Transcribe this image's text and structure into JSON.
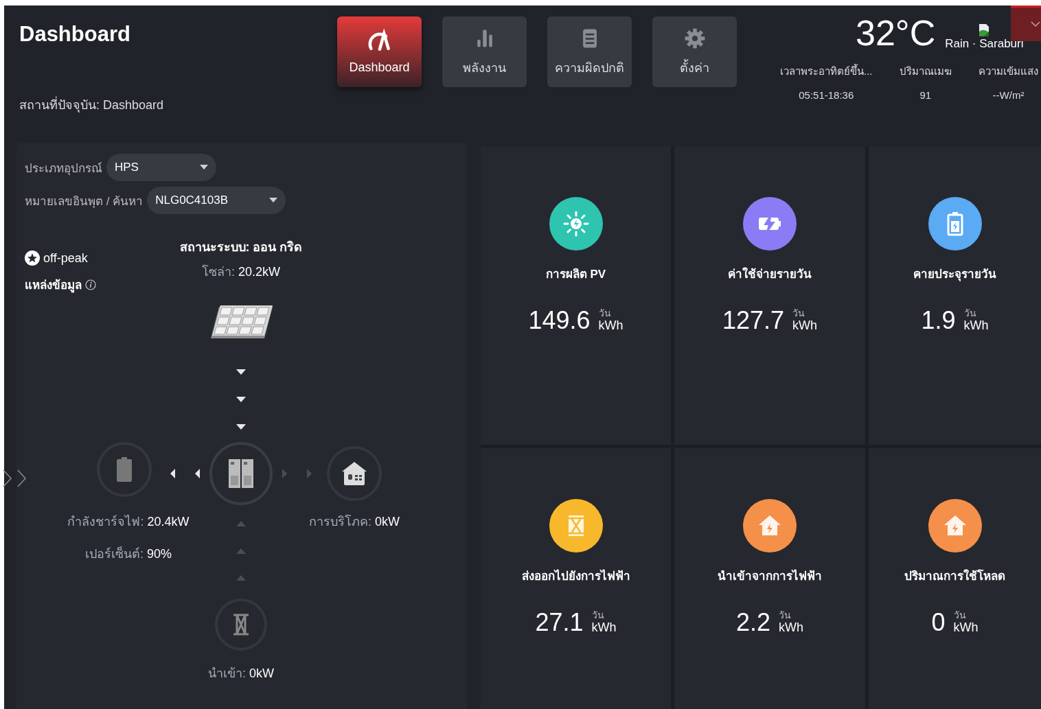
{
  "header": {
    "title": "Dashboard",
    "location": "สถานที่ปัจจุบัน: Dashboard"
  },
  "nav": [
    {
      "label": "Dashboard",
      "kind": "gauge",
      "selected": true
    },
    {
      "label": "พลังงาน",
      "kind": "bars",
      "selected": false
    },
    {
      "label": "ความผิดปกติ",
      "kind": "list",
      "selected": false
    },
    {
      "label": "ตั้งค่า",
      "kind": "gear",
      "selected": false
    }
  ],
  "weather": {
    "temperature": "32°C",
    "condition": "Rain · Saraburi",
    "stats": [
      {
        "label": "เวลาพระอาทิตย์ขึ้น...",
        "value": "05:51-18:36"
      },
      {
        "label": "ปริมาณเมฆ",
        "value": "91"
      },
      {
        "label": "ความเข้มแสง",
        "value": "--W/m²"
      }
    ]
  },
  "filters": [
    {
      "label": "ประเภทอุปกรณ์",
      "value": "HPS"
    },
    {
      "label": "หมายเลขอินพุต / ค้นหา",
      "value": "NLG0C4103B"
    }
  ],
  "tariff": "off-peak",
  "source": "แหล่งข้อมูล",
  "flow": {
    "status_label": "สถานะระบบ:",
    "status_value": "ออน กริด",
    "solar": {
      "label": "โซล่า:",
      "value": "20.2kW",
      "active": true
    },
    "battery": {
      "label": "กำลังชาร์จไฟ:",
      "value": "20.4kW",
      "percent_label": "เปอร์เซ็นต์:",
      "percent_value": "90%",
      "active": true
    },
    "load": {
      "label": "การบริโภค:",
      "value": "0kW",
      "active": false
    },
    "grid": {
      "label": "นำเข้า:",
      "value": "0kW",
      "active": false
    }
  },
  "stats": [
    {
      "kind": "sun",
      "color": "#2ec4b0",
      "title": "การผลิต PV",
      "value": "149.6",
      "period": "วัน",
      "unit": "kWh"
    },
    {
      "kind": "charge",
      "color": "#8a7cf4",
      "title": "ค่าใช้จ่ายรายวัน",
      "value": "127.7",
      "period": "วัน",
      "unit": "kWh"
    },
    {
      "kind": "battery",
      "color": "#5aaaf4",
      "title": "คายประจุรายวัน",
      "value": "1.9",
      "period": "วัน",
      "unit": "kWh"
    },
    {
      "kind": "tower",
      "color": "#f8b82c",
      "title": "ส่งออกไปยังการไฟฟ้า",
      "value": "27.1",
      "period": "วัน",
      "unit": "kWh"
    },
    {
      "kind": "house",
      "color": "#f5904a",
      "title": "นำเข้าจากการไฟฟ้า",
      "value": "2.2",
      "period": "วัน",
      "unit": "kWh"
    },
    {
      "kind": "house",
      "color": "#f5904a",
      "title": "ปริมาณการใช้โหลด",
      "value": "0",
      "period": "วัน",
      "unit": "kWh"
    }
  ]
}
